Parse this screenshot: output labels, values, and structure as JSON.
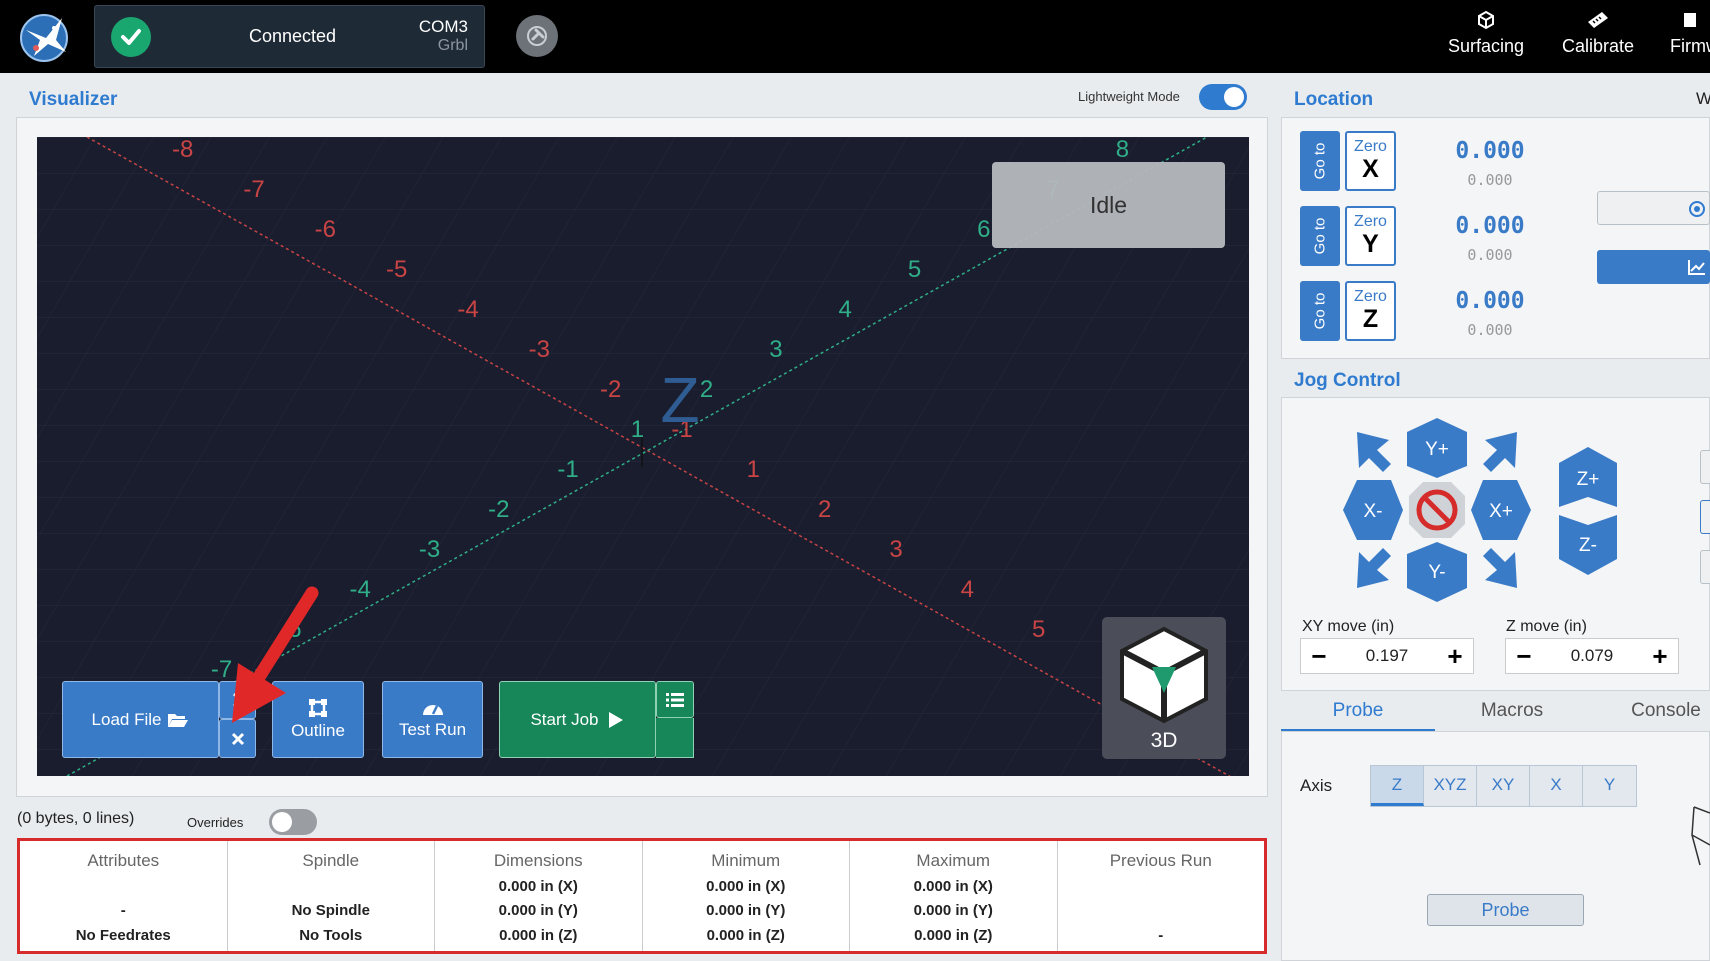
{
  "connection": {
    "status": "Connected",
    "port": "COM3",
    "firmware": "Grbl"
  },
  "nav": {
    "items": [
      {
        "label": "Surfacing",
        "icon": "cube-outline-icon"
      },
      {
        "label": "Calibrate",
        "icon": "ruler-icon"
      },
      {
        "label": "Firmw",
        "icon": "firmware-icon"
      }
    ]
  },
  "visualizer": {
    "title": "Visualizer",
    "lightweight_label": "Lightweight Mode",
    "lightweight_on": true,
    "state": "Idle",
    "view_label": "3D",
    "buttons": {
      "load_file": "Load File",
      "outline": "Outline",
      "test_run": "Test Run",
      "start_job": "Start Job"
    },
    "axis_labels": {
      "center": "Z",
      "x_axis": [
        "-8",
        "-7",
        "-6",
        "-5",
        "-4",
        "-3",
        "-2",
        "-1",
        "1",
        "2",
        "3",
        "4",
        "5",
        "6",
        "8"
      ],
      "y_axis": [
        "-7",
        "-6",
        "-4",
        "-3",
        "-2",
        "-1",
        "1",
        "2",
        "3",
        "4",
        "5",
        "6",
        "7",
        "8"
      ]
    }
  },
  "file": {
    "info": "(0 bytes, 0 lines)",
    "overrides_label": "Overrides",
    "overrides_on": false,
    "attributes": [
      {
        "header": "Attributes",
        "lines": [
          "",
          "-",
          "No Feedrates"
        ]
      },
      {
        "header": "Spindle",
        "lines": [
          "",
          "No Spindle",
          "No Tools"
        ]
      },
      {
        "header": "Dimensions",
        "lines": [
          "0.000 in (X)",
          "0.000 in (Y)",
          "0.000 in (Z)"
        ]
      },
      {
        "header": "Minimum",
        "lines": [
          "0.000 in (X)",
          "0.000 in (Y)",
          "0.000 in (Z)"
        ]
      },
      {
        "header": "Maximum",
        "lines": [
          "0.000 in (X)",
          "0.000 in (Y)",
          "0.000 in (Z)"
        ]
      },
      {
        "header": "Previous Run",
        "lines": [
          "",
          "",
          "-"
        ]
      }
    ]
  },
  "location": {
    "title": "Location",
    "right_edge_text": "W",
    "goto_label": "Go to",
    "zero_label": "Zero",
    "axes": [
      {
        "axis": "X",
        "work": "0.000",
        "machine": "0.000"
      },
      {
        "axis": "Y",
        "work": "0.000",
        "machine": "0.000"
      },
      {
        "axis": "Z",
        "work": "0.000",
        "machine": "0.000"
      }
    ]
  },
  "jog": {
    "title": "Jog Control",
    "labels": {
      "yplus": "Y+",
      "yminus": "Y-",
      "xplus": "X+",
      "xminus": "X-",
      "zplus": "Z+",
      "zminus": "Z-"
    },
    "xy_move_label": "XY move (in)",
    "xy_move_value": "0.197",
    "z_move_label": "Z move (in)",
    "z_move_value": "0.079"
  },
  "tabs": [
    "Probe",
    "Macros",
    "Console"
  ],
  "probe": {
    "axis_label": "Axis",
    "axes": [
      "Z",
      "XYZ",
      "XY",
      "X",
      "Y"
    ],
    "selected": "Z",
    "button": "Probe"
  },
  "colors": {
    "accent": "#2f7bd0",
    "button_blue": "#3a7bc8",
    "start_green": "#17875a",
    "viewport_bg": "#1a1d2e",
    "x_axis": "#c94444",
    "y_axis": "#2fae88",
    "highlight": "#d62b2b"
  }
}
